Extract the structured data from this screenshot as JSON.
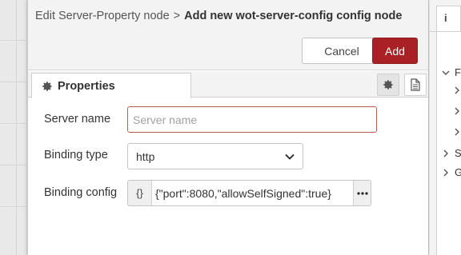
{
  "breadcrumb": {
    "parent": "Edit Server-Property node",
    "separator": ">",
    "current": "Add new wot-server-config config node"
  },
  "buttons": {
    "cancel": "Cancel",
    "add": "Add"
  },
  "tabs": {
    "properties": "Properties"
  },
  "form": {
    "server_name": {
      "label": "Server name",
      "placeholder": "Server name",
      "value": ""
    },
    "binding_type": {
      "label": "Binding type",
      "selected": "http"
    },
    "binding_config": {
      "label": "Binding config",
      "type_icon": "{}",
      "value": "{\"port\":8080,\"allowSelfSigned\":true}"
    }
  },
  "sidebar": {
    "tab_label": "i",
    "tree": [
      {
        "label": "F",
        "state": "expanded",
        "level": 0
      },
      {
        "label": "",
        "state": "collapsed",
        "level": 1
      },
      {
        "label": "",
        "state": "collapsed",
        "level": 1
      },
      {
        "label": "",
        "state": "collapsed",
        "level": 1
      },
      {
        "label": "S",
        "state": "collapsed",
        "level": 0
      },
      {
        "label": "G",
        "state": "collapsed",
        "level": 0
      }
    ]
  },
  "colors": {
    "accent": "#a92125",
    "error_border": "#bf5b50"
  },
  "icons": {
    "properties_tab": "gear-icon",
    "settings_tab": "gear-icon",
    "description_tab": "document-icon",
    "select_chevron": "chevron-down-icon",
    "expand_editor": "ellipsis-icon"
  }
}
